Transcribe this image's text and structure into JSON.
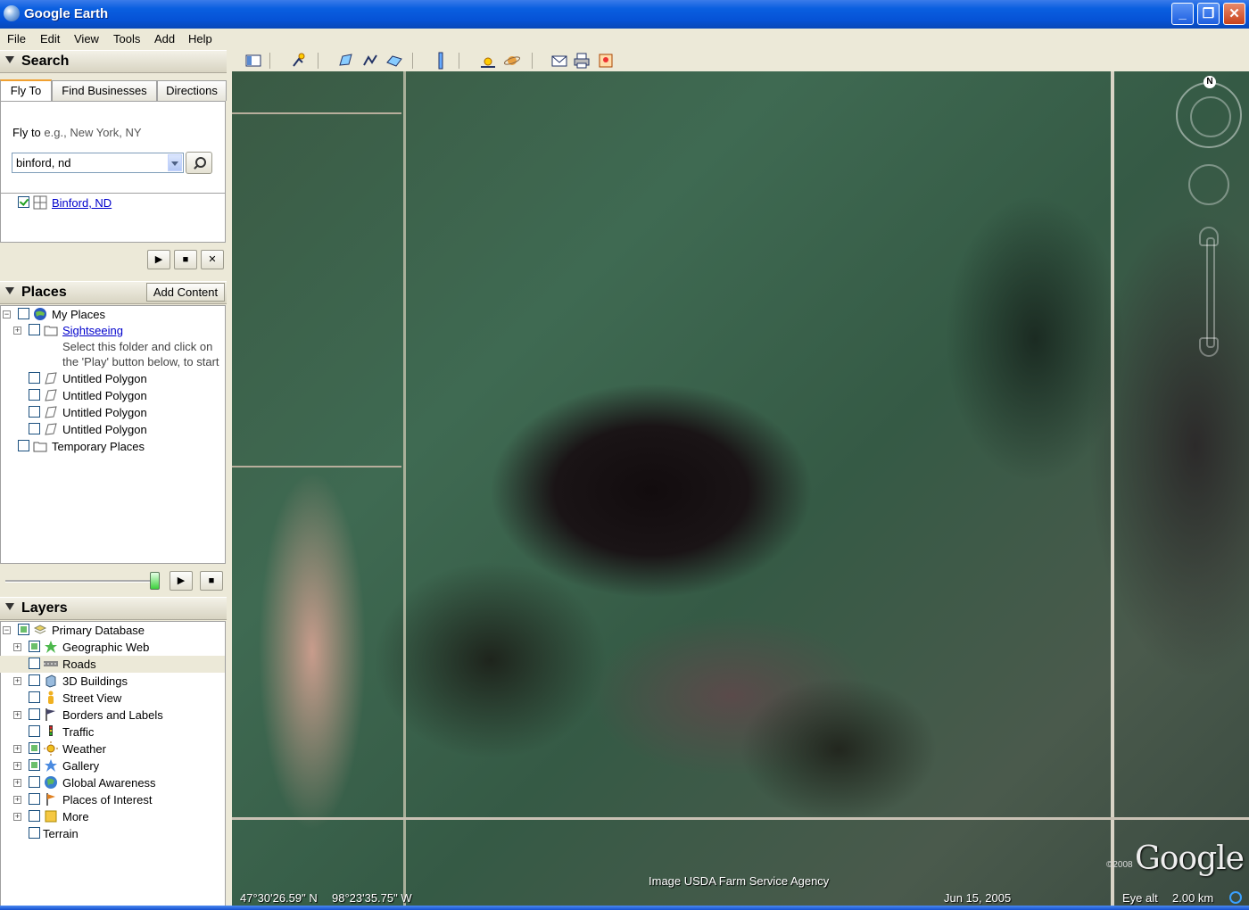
{
  "window": {
    "title": "Google Earth"
  },
  "menu": [
    "File",
    "Edit",
    "View",
    "Tools",
    "Add",
    "Help"
  ],
  "search": {
    "header": "Search",
    "tabs": [
      "Fly To",
      "Find Businesses",
      "Directions"
    ],
    "flyto_label": "Fly to",
    "flyto_hint": "e.g., New York, NY",
    "flyto_value": "binford, nd",
    "result": "Binford, ND"
  },
  "places": {
    "header": "Places",
    "add_content": "Add Content",
    "items": [
      {
        "label": "My Places"
      },
      {
        "label": "Sightseeing",
        "note1": "Select this folder and click on",
        "note2": "the 'Play' button below, to start"
      },
      {
        "label": "Untitled Polygon"
      },
      {
        "label": "Untitled Polygon"
      },
      {
        "label": "Untitled Polygon"
      },
      {
        "label": "Untitled Polygon"
      },
      {
        "label": "Temporary Places"
      }
    ]
  },
  "layers": {
    "header": "Layers",
    "items": [
      {
        "label": "Primary Database"
      },
      {
        "label": "Geographic Web"
      },
      {
        "label": "Roads"
      },
      {
        "label": "3D Buildings"
      },
      {
        "label": "Street View"
      },
      {
        "label": "Borders and Labels"
      },
      {
        "label": "Traffic"
      },
      {
        "label": "Weather"
      },
      {
        "label": "Gallery"
      },
      {
        "label": "Global Awareness"
      },
      {
        "label": "Places of Interest"
      },
      {
        "label": "More"
      },
      {
        "label": "Terrain"
      }
    ]
  },
  "map": {
    "credit": "Image USDA Farm Service Agency",
    "logo": "Google",
    "copyright": "©2008",
    "compass_n": "N"
  },
  "status": {
    "lat": "47°30'26.59\" N",
    "lon": "98°23'35.75\" W",
    "date": "Jun 15, 2005",
    "eye_label": "Eye alt",
    "eye_value": "2.00 km"
  }
}
